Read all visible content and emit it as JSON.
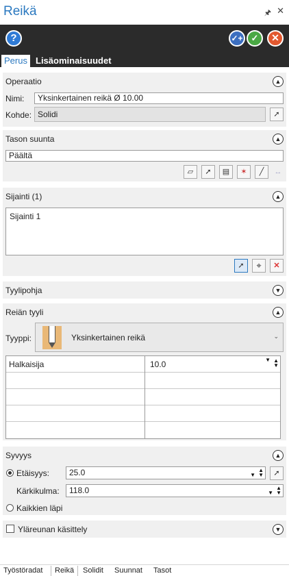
{
  "window": {
    "title": "Reikä",
    "pin_icon": "pin-icon",
    "close_icon": "close-icon"
  },
  "actions": {
    "help_icon": "?",
    "apply_new_icon": "✓+",
    "ok_icon": "✓",
    "cancel_icon": "✕"
  },
  "tabs": {
    "basic": "Perus",
    "advanced": "Lisäominaisuudet"
  },
  "operation": {
    "title": "Operaatio",
    "name_label": "Nimi:",
    "name_value": "Yksinkertainen reikä Ø 10.00",
    "target_label": "Kohde:",
    "target_value": "Solidi"
  },
  "plane": {
    "title": "Tason suunta",
    "value": "Päältä"
  },
  "location": {
    "title": "Sijainti (1)",
    "items": [
      "Sijainti 1"
    ]
  },
  "template": {
    "title": "Tyylipohja"
  },
  "hole_style": {
    "title": "Reiän tyyli",
    "type_label": "Tyyppi:",
    "type_value": "Yksinkertainen reikä",
    "param_rows": [
      {
        "name": "Halkaisija",
        "value": "10.0"
      },
      {
        "name": "",
        "value": ""
      },
      {
        "name": "",
        "value": ""
      },
      {
        "name": "",
        "value": ""
      },
      {
        "name": "",
        "value": ""
      }
    ]
  },
  "depth": {
    "title": "Syvyys",
    "distance_label": "Etäisyys:",
    "distance_value": "25.0",
    "tip_angle_label": "Kärkikulma:",
    "tip_angle_value": "118.0",
    "through_all_label": "Kaikkien läpi",
    "selected": "distance"
  },
  "top_edge": {
    "label": "Yläreunan käsittely",
    "checked": false
  },
  "bottom_tabs": [
    "Työstöradat",
    "Reikä",
    "Solidit",
    "Suunnat",
    "Tasot"
  ],
  "colors": {
    "accent": "#2b79c0",
    "dark_bar": "#2b2b2b",
    "ok": "#4aa844",
    "cancel": "#e2582f"
  }
}
